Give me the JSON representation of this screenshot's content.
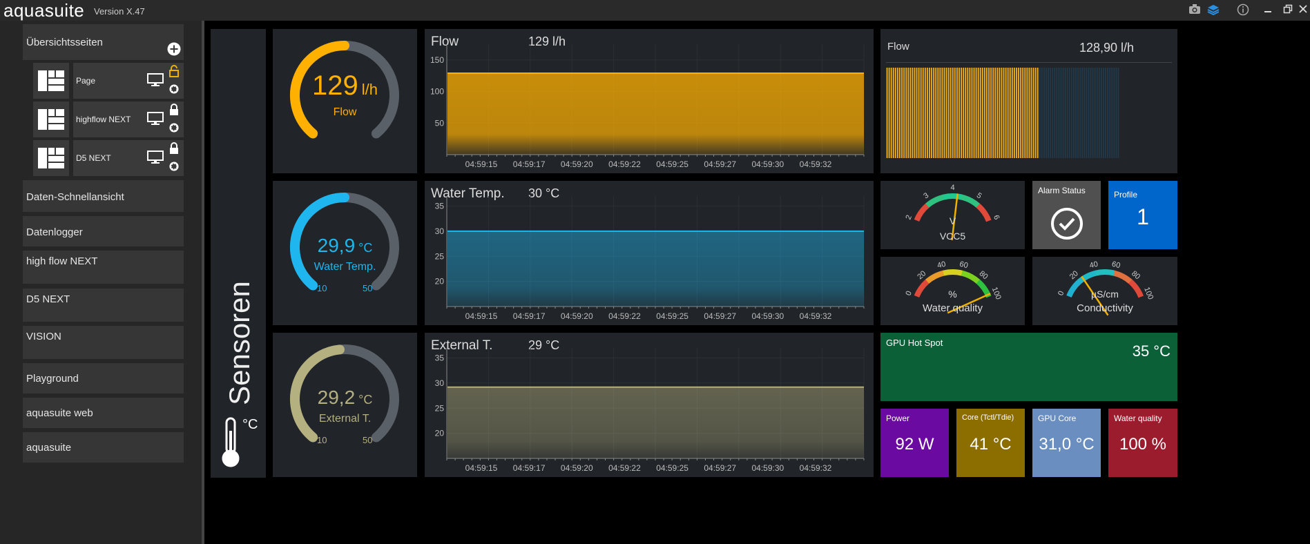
{
  "app": {
    "title": "aquasuite",
    "version": "Version X.47"
  },
  "sidebar": {
    "header": "Übersichtsseiten",
    "pages": [
      {
        "label": "Page",
        "locked": "open"
      },
      {
        "label": "highflow NEXT",
        "locked": "closed"
      },
      {
        "label": "D5 NEXT",
        "locked": "closed"
      }
    ],
    "items": [
      "Daten-Schnellansicht",
      "Datenlogger",
      "high flow NEXT",
      "D5 NEXT",
      "VISION",
      "Playground",
      "aquasuite web",
      "aquasuite"
    ]
  },
  "sensor_panel": {
    "title": "Sensoren",
    "unit": "°C"
  },
  "gauges": [
    {
      "value": "129",
      "unit": "l/h",
      "label": "Flow",
      "min": "",
      "max": "",
      "color": "#ffb000",
      "fraction": 0.5
    },
    {
      "value": "29,9",
      "unit": "°C",
      "label": "Water Temp.",
      "min": "10",
      "max": "50",
      "color": "#1fb6ef",
      "fraction": 0.5
    },
    {
      "value": "29,2",
      "unit": "°C",
      "label": "External T.",
      "min": "10",
      "max": "50",
      "color": "#b4b080",
      "fraction": 0.48
    }
  ],
  "charts": [
    {
      "title": "Flow",
      "value": "129 l/h"
    },
    {
      "title": "Water Temp.",
      "value": "30 °C"
    },
    {
      "title": "External T.",
      "value": "29 °C"
    }
  ],
  "chart_data": [
    {
      "type": "area",
      "title": "Flow",
      "x": [
        "04:59:15",
        "04:59:17",
        "04:59:20",
        "04:59:22",
        "04:59:25",
        "04:59:27",
        "04:59:30",
        "04:59:32"
      ],
      "yticks": [
        50,
        100,
        150
      ],
      "ylim": [
        0,
        175
      ],
      "series": [
        {
          "values": [
            129,
            129,
            129,
            129,
            129,
            129,
            129,
            129
          ]
        }
      ],
      "color": "#ffb000"
    },
    {
      "type": "area",
      "title": "Water Temp.",
      "x": [
        "04:59:15",
        "04:59:17",
        "04:59:20",
        "04:59:22",
        "04:59:25",
        "04:59:27",
        "04:59:30",
        "04:59:32"
      ],
      "yticks": [
        20,
        25,
        30,
        35
      ],
      "ylim": [
        15,
        37
      ],
      "series": [
        {
          "values": [
            30,
            30,
            30,
            30,
            30,
            30,
            30,
            30
          ]
        }
      ],
      "color": "#1fb6ef"
    },
    {
      "type": "area",
      "title": "External T.",
      "x": [
        "04:59:15",
        "04:59:17",
        "04:59:20",
        "04:59:22",
        "04:59:25",
        "04:59:27",
        "04:59:30",
        "04:59:32"
      ],
      "yticks": [
        20,
        25,
        30,
        35
      ],
      "ylim": [
        15,
        37
      ],
      "series": [
        {
          "values": [
            29.2,
            29.2,
            29.2,
            29.2,
            29.2,
            29.2,
            29.2,
            29.2
          ]
        }
      ],
      "color": "#b4b080"
    }
  ],
  "flow_bar": {
    "title": "Flow",
    "value": "128,90 l/h",
    "fill_fraction": 0.65
  },
  "dials": [
    {
      "label": "VCC5",
      "unit": "V",
      "ticks": [
        "2",
        "3",
        "4",
        "5",
        "6"
      ],
      "needle_fraction": 0.55
    },
    {
      "label": "Water quality",
      "unit": "%",
      "ticks": [
        "0",
        "20",
        "40",
        "60",
        "80",
        "100"
      ],
      "needle_fraction": 0.98
    },
    {
      "label": "Conductivity",
      "unit": "µS/cm",
      "ticks": [
        "0",
        "20",
        "40",
        "60",
        "80",
        "100"
      ],
      "needle_fraction": 0.25
    }
  ],
  "alarm": {
    "label": "Alarm Status"
  },
  "profile": {
    "label": "Profile",
    "value": "1"
  },
  "gpu_hotspot": {
    "label": "GPU Hot Spot",
    "value": "35 °C"
  },
  "tiles": [
    {
      "label": "Power",
      "value": "92 W",
      "color": "#6a0aa0"
    },
    {
      "label": "Core (Tctl/Tdie)",
      "value": "41 °C",
      "color": "#8c6d00"
    },
    {
      "label": "GPU Core",
      "value": "31,0 °C",
      "color": "#6a8ec0"
    },
    {
      "label": "Water quality",
      "value": "100 %",
      "color": "#9b1c2c"
    }
  ]
}
